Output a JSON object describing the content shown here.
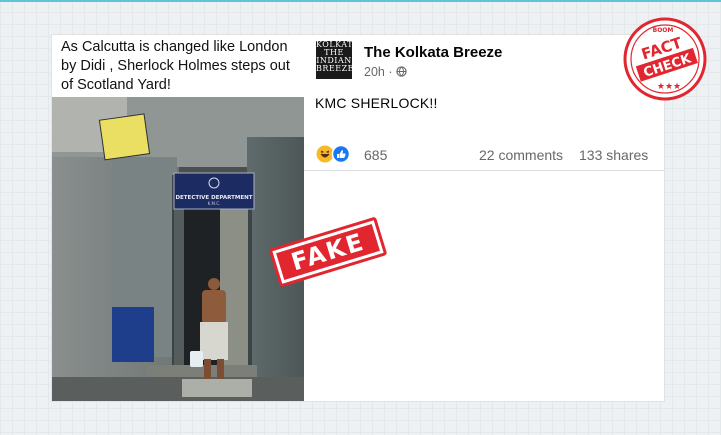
{
  "colors": {
    "accent_red": "#e1262f",
    "fb_blue": "#1877f2",
    "caption_text": "#111111",
    "muted": "#65676b"
  },
  "left_panel": {
    "caption": "As Calcutta is changed like London by Didi , Sherlock Holmes steps out of Scotland Yard!",
    "photo": {
      "sign_main": "DETECTIVE DEPARTMENT",
      "sign_sub": "K.M.C."
    }
  },
  "post": {
    "page_name": "The Kolkata Breeze",
    "time": "20h ·",
    "avatar_text": [
      "KOLKATA",
      "THE",
      "INDIAN",
      "BREEZE"
    ],
    "text": "KMC SHERLOCK!!",
    "reactions": {
      "icons": [
        "haha-icon",
        "like-icon"
      ],
      "count": "685"
    },
    "comments": "22 comments",
    "shares": "133 shares"
  },
  "stamps": {
    "fake": "FAKE",
    "seal_top": "BOOM",
    "seal_main": [
      "FACT",
      "CHECK"
    ]
  }
}
